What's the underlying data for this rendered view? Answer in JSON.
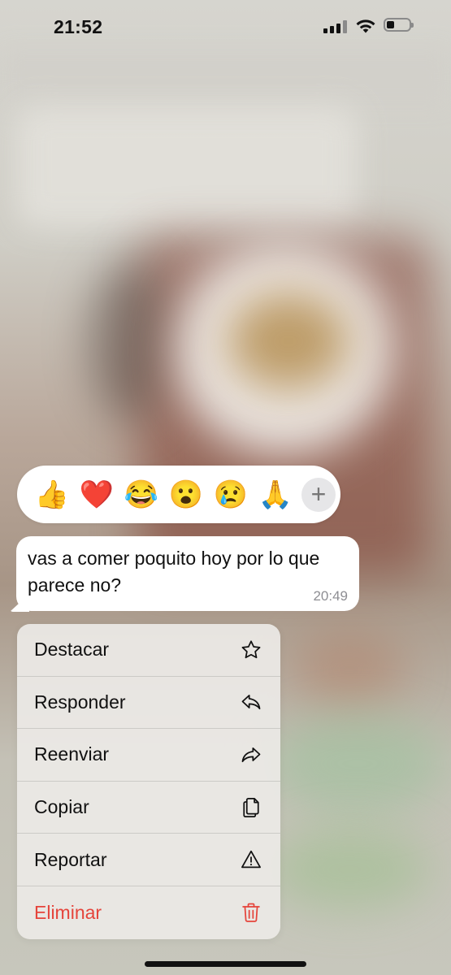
{
  "status_bar": {
    "time": "21:52"
  },
  "reactions": {
    "emojis": [
      "👍",
      "❤️",
      "😂",
      "😮",
      "😢",
      "🙏"
    ],
    "more": "+"
  },
  "message": {
    "text": "vas a comer poquito hoy por lo que parece no?",
    "time": "20:49"
  },
  "menu": {
    "items": [
      {
        "label": "Destacar",
        "icon": "star-icon"
      },
      {
        "label": "Responder",
        "icon": "reply-icon"
      },
      {
        "label": "Reenviar",
        "icon": "forward-icon"
      },
      {
        "label": "Copiar",
        "icon": "copy-icon"
      },
      {
        "label": "Reportar",
        "icon": "warning-icon"
      },
      {
        "label": "Eliminar",
        "icon": "trash-icon"
      }
    ]
  },
  "colors": {
    "danger": "#e5443b",
    "menu_bg": "#eceae6",
    "bubble": "#ffffff"
  }
}
